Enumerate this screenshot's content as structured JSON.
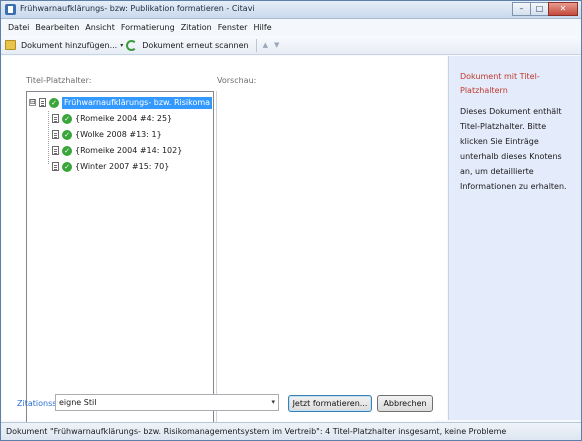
{
  "window": {
    "title": "Frühwarnaufklärungs- bzw: Publikation formatieren - Citavi",
    "minimize": "–",
    "maximize": "□",
    "close": "✕"
  },
  "menu": [
    "Datei",
    "Bearbeiten",
    "Ansicht",
    "Formatierung",
    "Zitation",
    "Fenster",
    "Hilfe"
  ],
  "toolbar": {
    "add_document": "Dokument hinzufügen...",
    "rescan_document": "Dokument erneut scannen",
    "dropdown_glyph": "▾",
    "up_glyph": "▲",
    "down_glyph": "▼"
  },
  "tree": {
    "label": "Titel-Platzhalter:",
    "root": {
      "label": "Frühwarnaufklärungs- bzw. Risikoma",
      "expander": "⊟",
      "type_icon": "doc-icon",
      "status_icon": "check-icon"
    },
    "items": [
      "{Romeike 2004 #4: 25}",
      "{Wolke 2008 #13: 1}",
      "{Romeike 2004 #14: 102}",
      "{Winter 2007 #15: 70}"
    ],
    "scroll_left": "◂",
    "scroll_right": "▸"
  },
  "preview": {
    "label": "Vorschau:"
  },
  "citation": {
    "label": "Zitationsstil:",
    "selected": "eigne Stil",
    "caret": "▾"
  },
  "buttons": {
    "format_now": "Jetzt formatieren...",
    "cancel": "Abbrechen"
  },
  "help": {
    "title": "Dokument mit Titel-Platzhaltern",
    "text": "Dieses Dokument enthält Titel-Platzhalter. Bitte klicken Sie Einträge unterhalb dieses Knotens an, um detaillierte Informationen zu erhalten."
  },
  "status": "Dokument \"Frühwarnaufklärungs- bzw. Risikomanagementsystem im Vertreib\": 4 Titel-Platzhalter insgesamt, keine Probleme",
  "colors": {
    "selection": "#3399ff",
    "help_title": "#c0392b",
    "help_background": "#e4ebfb",
    "citation_label": "#2b6fd0",
    "check": "#3aa53a"
  }
}
